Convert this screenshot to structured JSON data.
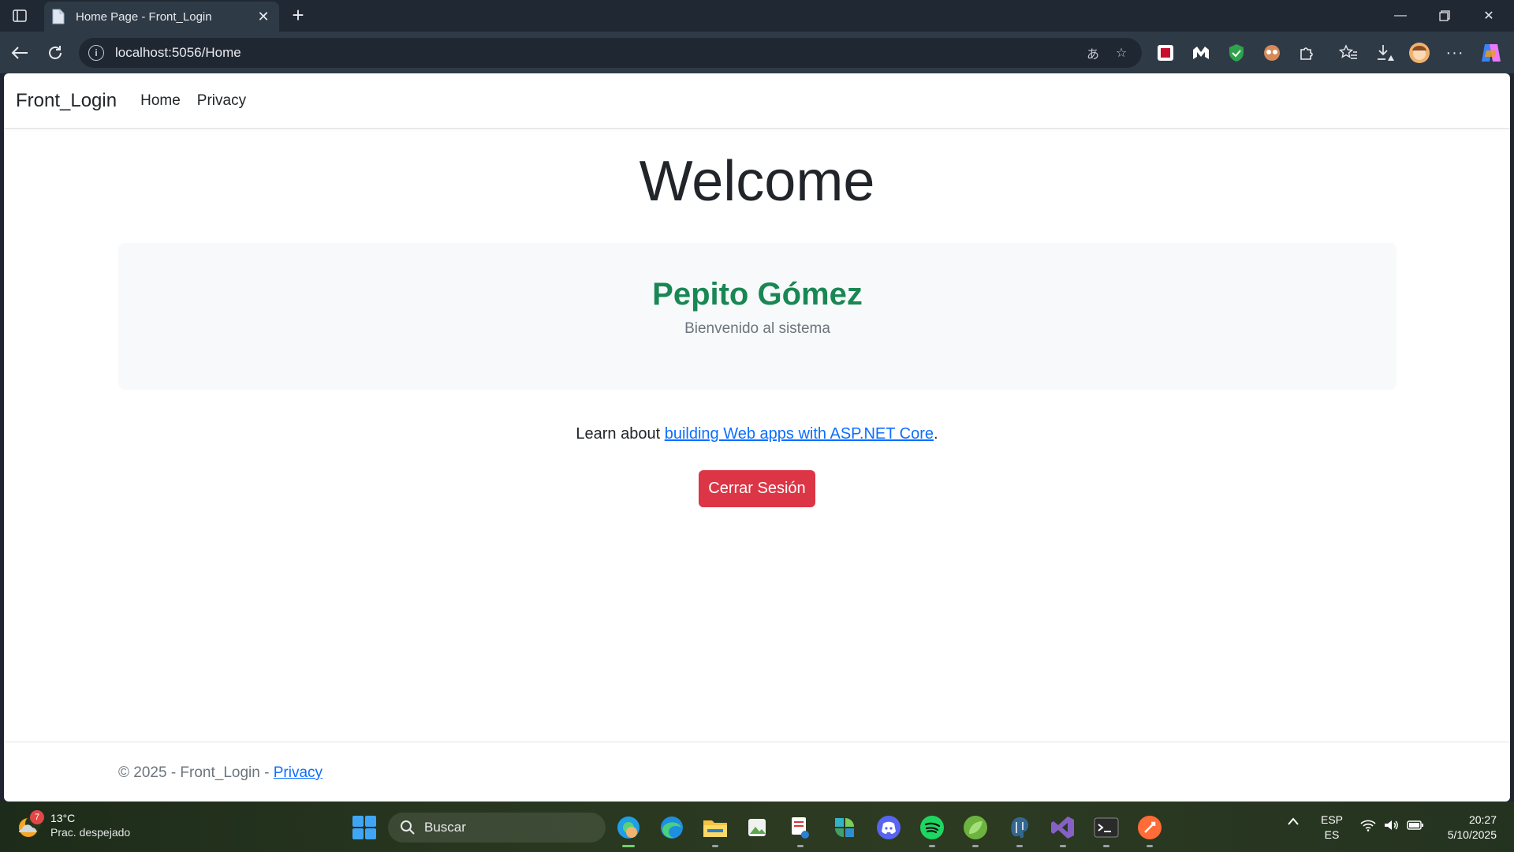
{
  "browser": {
    "tab_title": "Home Page - Front_Login",
    "new_tab": "+",
    "url": "localhost:5056/Home"
  },
  "site": {
    "brand": "Front_Login",
    "nav": [
      {
        "label": "Home"
      },
      {
        "label": "Privacy"
      }
    ],
    "heading": "Welcome",
    "user_name": "Pepito Gómez",
    "user_subtitle": "Bienvenido al sistema",
    "learn_prefix": "Learn about ",
    "learn_link": "building Web apps with ASP.NET Core",
    "learn_suffix": ".",
    "logout_button": "Cerrar Sesión",
    "footer_prefix": "© 2025 - Front_Login - ",
    "footer_link": "Privacy"
  },
  "taskbar": {
    "weather_temp": "13°C",
    "weather_desc": "Prac. despejado",
    "weather_badge": "7",
    "search_placeholder": "Buscar",
    "lang_top": "ESP",
    "lang_bottom": "ES",
    "time": "20:27",
    "date": "5/10/2025"
  },
  "colors": {
    "primary": "#0d6efd",
    "success": "#198754",
    "danger": "#dc3545",
    "browser_chrome": "#2f3a47"
  }
}
